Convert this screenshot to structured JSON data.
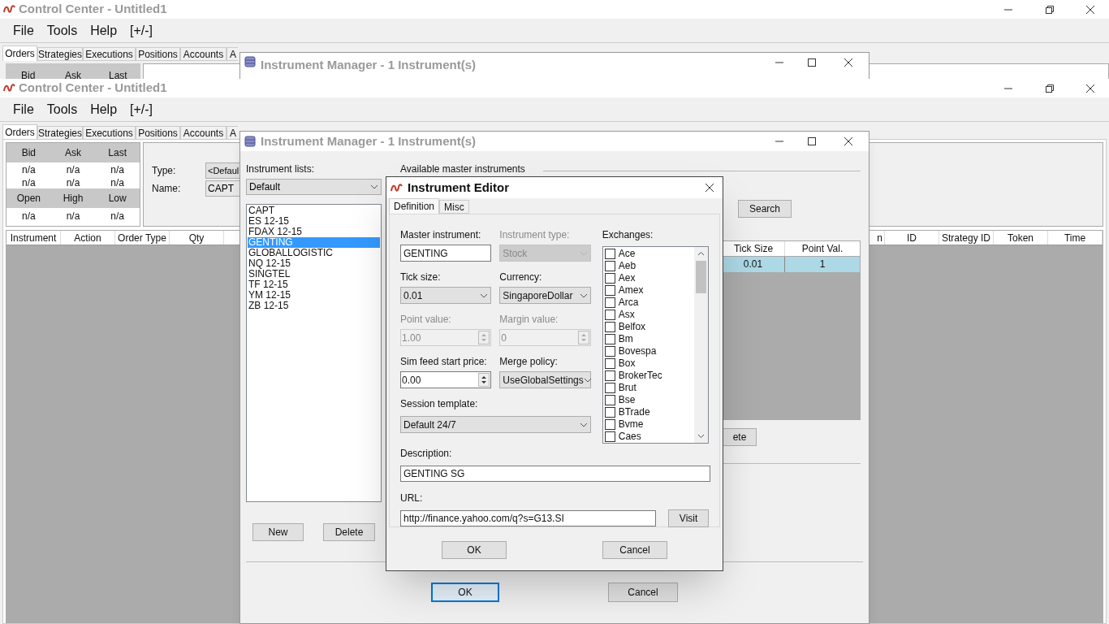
{
  "background_copy": {
    "title": "Control Center - Untitled1",
    "menu": [
      "File",
      "Tools",
      "Help",
      "[+/-]"
    ],
    "tabs": [
      {
        "label": "Orders",
        "selected": true
      },
      {
        "label": "Strategies",
        "selected": false
      },
      {
        "label": "Executions",
        "selected": false
      },
      {
        "label": "Positions",
        "selected": false
      },
      {
        "label": "Accounts",
        "selected": false
      },
      {
        "label": "A",
        "selected": false
      }
    ],
    "quote_header": [
      "Bid",
      "Ask",
      "Last"
    ],
    "overlay_title": "Instrument Manager - 1 Instrument(s)"
  },
  "control_center": {
    "title": "Control Center - Untitled1",
    "menu": [
      "File",
      "Tools",
      "Help",
      "[+/-]"
    ],
    "tabs": [
      {
        "label": "Orders",
        "selected": true
      },
      {
        "label": "Strategies",
        "selected": false
      },
      {
        "label": "Executions",
        "selected": false
      },
      {
        "label": "Positions",
        "selected": false
      },
      {
        "label": "Accounts",
        "selected": false
      },
      {
        "label": "A",
        "selected": false
      }
    ],
    "quote": [
      {
        "kind": "header",
        "cells": [
          "Bid",
          "Ask",
          "Last"
        ]
      },
      {
        "kind": "values",
        "cells": [
          "n/a",
          "n/a",
          "n/a"
        ]
      },
      {
        "kind": "values",
        "cells": [
          "n/a",
          "n/a",
          "n/a"
        ]
      },
      {
        "kind": "header",
        "cells": [
          "Open",
          "High",
          "Low"
        ]
      },
      {
        "kind": "values",
        "cells": [
          "n/a",
          "n/a",
          "n/a"
        ]
      }
    ],
    "type_label": "Type:",
    "type_value": "<Defaul",
    "name_label": "Name:",
    "name_value": "CAPT",
    "columns_left": [
      "Instrument",
      "Action",
      "Order Type",
      "Qty"
    ],
    "columns_right": [
      "n",
      "ID",
      "Strategy ID",
      "Token",
      "Time"
    ]
  },
  "instrument_manager": {
    "title": "Instrument Manager - 1 Instrument(s)",
    "lists_label": "Instrument lists:",
    "list_select": "Default",
    "instruments": [
      {
        "label": "CAPT",
        "selected": false
      },
      {
        "label": "ES 12-15",
        "selected": false
      },
      {
        "label": "FDAX 12-15",
        "selected": false
      },
      {
        "label": "GENTING",
        "selected": true
      },
      {
        "label": "GLOBALLOGISTIC",
        "selected": false
      },
      {
        "label": "NQ 12-15",
        "selected": false
      },
      {
        "label": "SINGTEL",
        "selected": false
      },
      {
        "label": "TF 12-15",
        "selected": false
      },
      {
        "label": "YM 12-15",
        "selected": false
      },
      {
        "label": "ZB 12-15",
        "selected": false
      }
    ],
    "new_button": "New",
    "delete_button": "Delete",
    "available_label": "Available master instruments",
    "search_button": "Search",
    "table": {
      "columns": [
        "Tick Size",
        "Point Val."
      ],
      "rows": [
        {
          "cells": [
            "0.01",
            "1"
          ],
          "selected": true
        }
      ]
    },
    "partial_button": "ete",
    "ok_button": "OK",
    "cancel_button": "Cancel"
  },
  "instrument_editor": {
    "title": "Instrument Editor",
    "tabs": [
      {
        "label": "Definition",
        "selected": true
      },
      {
        "label": "Misc",
        "selected": false
      }
    ],
    "fields": [
      {
        "kind": "text",
        "label": "Master instrument:",
        "value": "GENTING",
        "disabled": false
      },
      {
        "kind": "select",
        "label": "Instrument type:",
        "value": "Stock",
        "disabled": true
      },
      {
        "kind": "select",
        "label": "Tick size:",
        "value": "0.01",
        "disabled": false
      },
      {
        "kind": "select",
        "label": "Currency:",
        "value": "SingaporeDollar",
        "disabled": false
      },
      {
        "kind": "spinner",
        "label": "Point value:",
        "value": "1.00",
        "disabled": true
      },
      {
        "kind": "spinner",
        "label": "Margin value:",
        "value": "0",
        "disabled": true
      },
      {
        "kind": "spinner",
        "label": "Sim feed start price:",
        "value": "0.00",
        "disabled": false
      },
      {
        "kind": "select",
        "label": "Merge policy:",
        "value": "UseGlobalSettings",
        "disabled": false
      }
    ],
    "session_template": {
      "label": "Session template:",
      "value": "Default 24/7"
    },
    "exchanges_label": "Exchanges:",
    "exchanges": [
      {
        "label": "Ace",
        "checked": false
      },
      {
        "label": "Aeb",
        "checked": false
      },
      {
        "label": "Aex",
        "checked": false
      },
      {
        "label": "Amex",
        "checked": false
      },
      {
        "label": "Arca",
        "checked": false
      },
      {
        "label": "Asx",
        "checked": false
      },
      {
        "label": "Belfox",
        "checked": false
      },
      {
        "label": "Bm",
        "checked": false
      },
      {
        "label": "Bovespa",
        "checked": false
      },
      {
        "label": "Box",
        "checked": false
      },
      {
        "label": "BrokerTec",
        "checked": false
      },
      {
        "label": "Brut",
        "checked": false
      },
      {
        "label": "Bse",
        "checked": false
      },
      {
        "label": "BTrade",
        "checked": false
      },
      {
        "label": "Bvme",
        "checked": false
      },
      {
        "label": "Caes",
        "checked": false
      }
    ],
    "description": {
      "label": "Description:",
      "value": "GENTING SG"
    },
    "url": {
      "label": "URL:",
      "value": "http://finance.yahoo.com/q?s=G13.SI"
    },
    "visit_button": "Visit",
    "ok_button": "OK",
    "cancel_button": "Cancel"
  }
}
